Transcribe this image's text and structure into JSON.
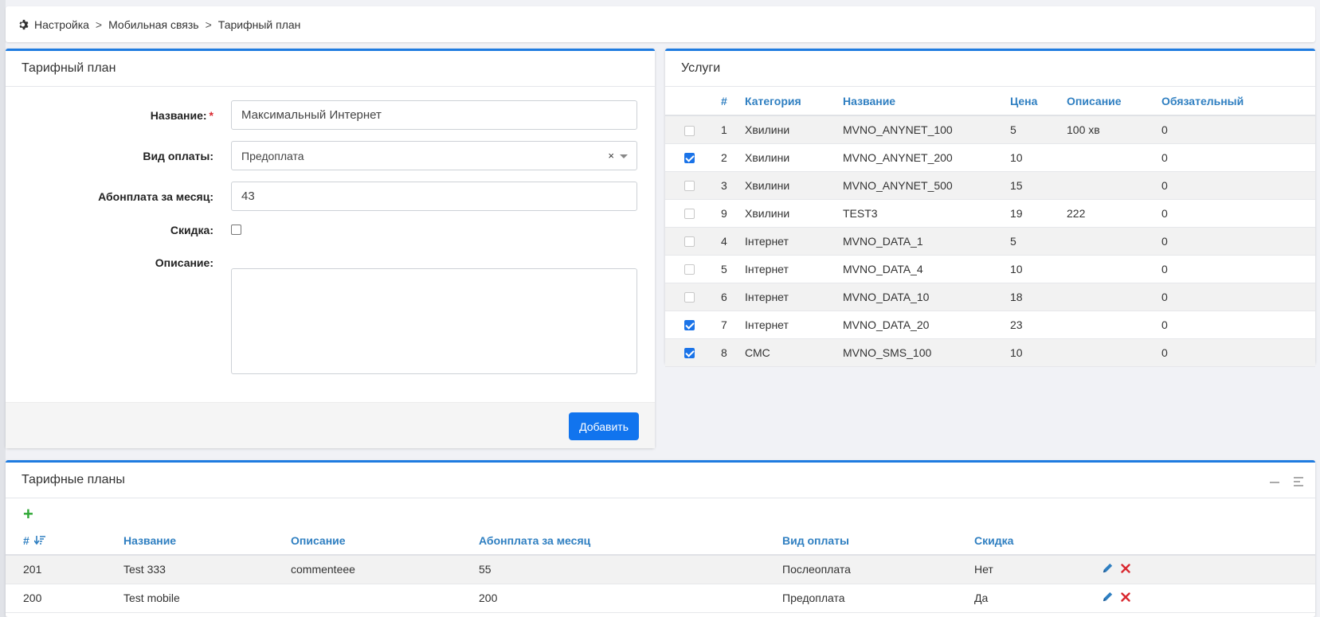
{
  "breadcrumb": {
    "items": [
      "Настройка",
      "Мобильная связь",
      "Тарифный план"
    ],
    "separator": ">"
  },
  "form": {
    "title": "Тарифный план",
    "name_label": "Название:",
    "name_required_mark": "*",
    "name_value": "Максимальный Интернет",
    "payment_label": "Вид оплаты:",
    "payment_value": "Предоплата",
    "payment_clear": "×",
    "fee_label": "Абонплата за месяц:",
    "fee_value": "43",
    "discount_label": "Скидка:",
    "discount_checked": false,
    "description_label": "Описание:",
    "description_value": "",
    "submit_label": "Добавить"
  },
  "services": {
    "title": "Услуги",
    "columns": [
      "#",
      "Категория",
      "Название",
      "Цена",
      "Описание",
      "Обязательный"
    ],
    "rows": [
      {
        "checked": false,
        "id": "1",
        "category": "Хвилини",
        "name": "MVNO_ANYNET_100",
        "price": "5",
        "description": "100 хв",
        "required": "0"
      },
      {
        "checked": true,
        "id": "2",
        "category": "Хвилини",
        "name": "MVNO_ANYNET_200",
        "price": "10",
        "description": "",
        "required": "0"
      },
      {
        "checked": false,
        "id": "3",
        "category": "Хвилини",
        "name": "MVNO_ANYNET_500",
        "price": "15",
        "description": "",
        "required": "0"
      },
      {
        "checked": false,
        "id": "9",
        "category": "Хвилини",
        "name": "TEST3",
        "price": "19",
        "description": "222",
        "required": "0"
      },
      {
        "checked": false,
        "id": "4",
        "category": "Інтернет",
        "name": "MVNO_DATA_1",
        "price": "5",
        "description": "",
        "required": "0"
      },
      {
        "checked": false,
        "id": "5",
        "category": "Інтернет",
        "name": "MVNO_DATA_4",
        "price": "10",
        "description": "",
        "required": "0"
      },
      {
        "checked": false,
        "id": "6",
        "category": "Інтернет",
        "name": "MVNO_DATA_10",
        "price": "18",
        "description": "",
        "required": "0"
      },
      {
        "checked": true,
        "id": "7",
        "category": "Інтернет",
        "name": "MVNO_DATA_20",
        "price": "23",
        "description": "",
        "required": "0"
      },
      {
        "checked": true,
        "id": "8",
        "category": "СМС",
        "name": "MVNO_SMS_100",
        "price": "10",
        "description": "",
        "required": "0"
      }
    ]
  },
  "plans": {
    "title": "Тарифные планы",
    "add_icon": "plus-icon",
    "columns": [
      "#",
      "Название",
      "Описание",
      "Абонплата за месяц",
      "Вид оплаты",
      "Скидка"
    ],
    "rows": [
      {
        "id": "201",
        "name": "Test 333",
        "description": "commenteee",
        "fee": "55",
        "payment": "Послеоплата",
        "discount": "Нет"
      },
      {
        "id": "200",
        "name": "Test mobile",
        "description": "",
        "fee": "200",
        "payment": "Предоплата",
        "discount": "Да"
      }
    ]
  },
  "colors": {
    "accent": "#1e7be0",
    "header_link": "#2f7fc1",
    "primary_button": "#1174ee",
    "add_green": "#2fa836",
    "delete_red": "#d9282f",
    "edit_blue": "#2f7fc1"
  }
}
